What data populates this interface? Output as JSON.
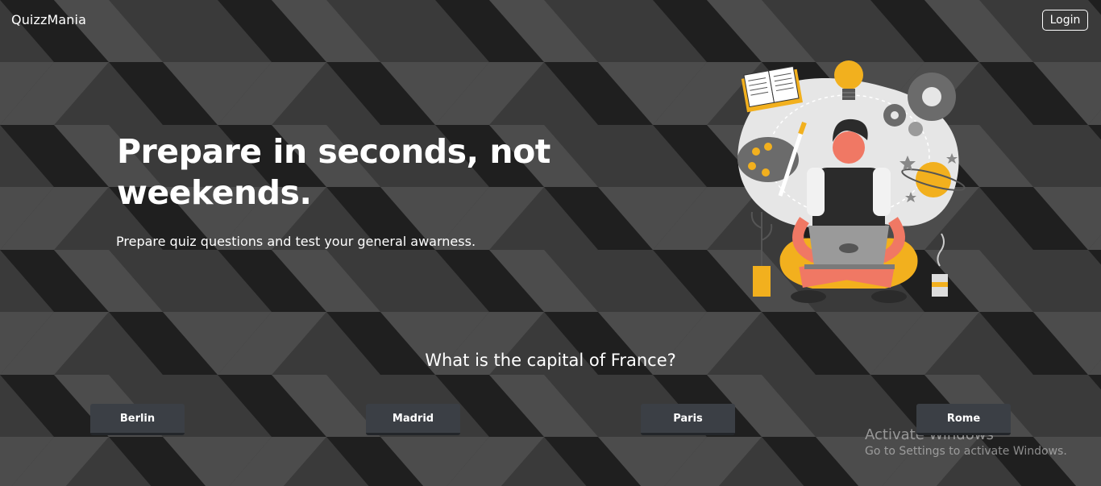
{
  "nav": {
    "brand": "QuizzMania",
    "login_label": "Login"
  },
  "hero": {
    "title": "Prepare in seconds, not weekends.",
    "subtitle": "Prepare quiz questions and test your general awarness."
  },
  "quiz": {
    "question": "What is the capital of France?",
    "options": [
      "Berlin",
      "Madrid",
      "Paris",
      "Rome"
    ]
  },
  "watermark": {
    "title": "Activate Windows",
    "subtitle": "Go to Settings to activate Windows."
  },
  "colors": {
    "background_dark": "#1f1f1f",
    "background_mid": "#3a3a3a",
    "background_light": "#4c4c4c",
    "button_bg": "#3b3f45",
    "accent_yellow": "#f2b01e",
    "accent_salmon": "#f07864"
  }
}
